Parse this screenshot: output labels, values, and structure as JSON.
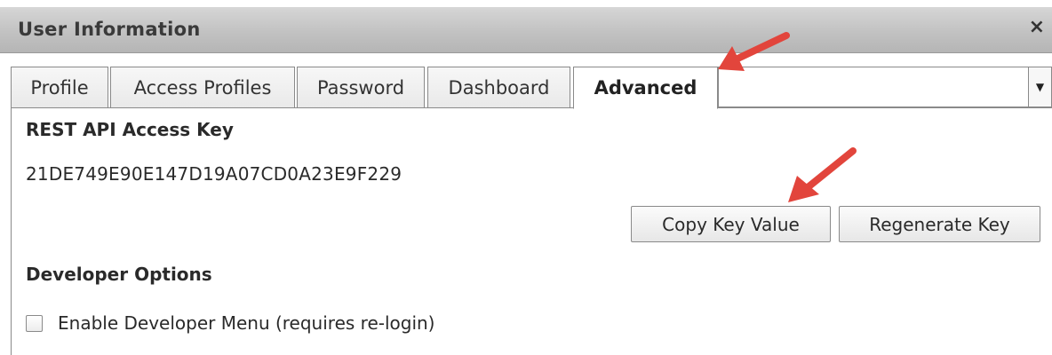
{
  "dialog": {
    "title": "User Information",
    "close_glyph": "×"
  },
  "tabs": [
    {
      "label": "Profile",
      "active": false
    },
    {
      "label": "Access Profiles",
      "active": false
    },
    {
      "label": "Password",
      "active": false
    },
    {
      "label": "Dashboard",
      "active": false
    },
    {
      "label": "Advanced",
      "active": true
    }
  ],
  "tab_overflow": {
    "value": "",
    "arrow_glyph": "▼"
  },
  "rest_api": {
    "heading": "REST API Access Key",
    "key": "21DE749E90E147D19A07CD0A23E9F229",
    "copy_button": "Copy Key Value",
    "regenerate_button": "Regenerate Key"
  },
  "developer": {
    "heading": "Developer Options",
    "checkbox_label": "Enable Developer Menu (requires re-login)",
    "checked": false
  },
  "annotations": {
    "arrow_color": "#e2453c"
  }
}
